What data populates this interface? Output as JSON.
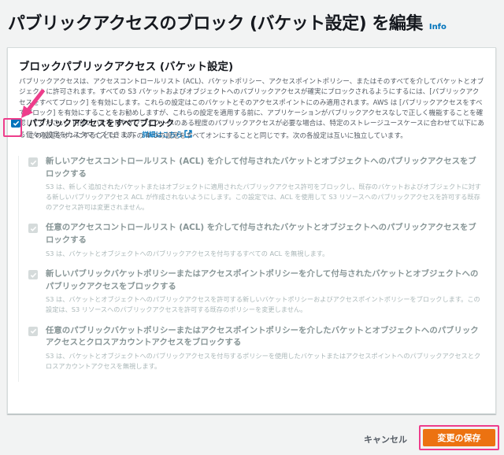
{
  "header": {
    "title": "パブリックアクセスのブロック (バケット設定) を編集",
    "info": "Info"
  },
  "panel": {
    "title": "ブロックパブリックアクセス (バケット設定)",
    "description": "パブリックアクセスは、アクセスコントロールリスト (ACL)、バケットポリシー、アクセスポイントポリシー、またはそのすべてを介してバケットとオブジェクトに許可されます。すべての S3 バケットおよびオブジェクトへのパブリックアクセスが確実にブロックされるようにするには、[パブリックアクセスをすべてブロック] を有効にします。これらの設定はこのバケットとそのアクセスポイントにのみ適用されます。AWS は [パブリックアクセスをすべてブロック] を有効にすることをお勧めしますが、これらの設定を適用する前に、アプリケーションがパブリックアクセスなしで正しく機能することを確認してください。内部のバケットやオブジェクトへのある程度のパブリックアクセスが必要な場合は、特定のストレージユースケースに合わせて以下にある個々の設定をカスタマイズできます。",
    "detail_link": "詳細はこちら"
  },
  "master": {
    "label": "パブリックアクセスをすべてブロック",
    "description": "この設定をオンにすることは、以下の 4 つの設定をすべてオンにすることと同じです。次の各設定は互いに独立しています。",
    "checked": true
  },
  "options": [
    {
      "title": "新しいアクセスコントロールリスト (ACL) を介して付与されたバケットとオブジェクトへのパブリックアクセスをブロックする",
      "description": "S3 は、新しく追加されたバケットまたはオブジェクトに適用されたパブリックアクセス許可をブロックし、既存のバケットおよびオブジェクトに対する新しいパブリックアクセス ACL が作成されないようにします。この設定では、ACL を使用して S3 リソースへのパブリックアクセスを許可する既存のアクセス許可は変更されません。"
    },
    {
      "title": "任意のアクセスコントロールリスト (ACL) を介して付与されたバケットとオブジェクトへのパブリックアクセスをブロックする",
      "description": "S3 は、バケットとオブジェクトへのパブリックアクセスを付与するすべての ACL を無視します。"
    },
    {
      "title": "新しいパブリックバケットポリシーまたはアクセスポイントポリシーを介して付与されたバケットとオブジェクトへのパブリックアクセスをブロックする",
      "description": "S3 は、バケットとオブジェクトへのパブリックアクセスを許可する新しいバケットポリシーおよびアクセスポイントポリシーをブロックします。この設定は、S3 リソースへのパブリックアクセスを許可する既存のポリシーを変更しません。"
    },
    {
      "title": "任意のパブリックバケットポリシーまたはアクセスポイントポリシーを介したバケットとオブジェクトへのパブリックアクセスとクロスアカウントアクセスをブロックする",
      "description": "S3 は、バケットとオブジェクトへのパブリックアクセスを付与するポリシーを使用したバケットまたはアクセスポイントへのパブリックアクセスとクロスアカウントアクセスを無視します。"
    }
  ],
  "footer": {
    "cancel_label": "キャンセル",
    "save_label": "変更の保存"
  },
  "colors": {
    "accent": "#0073bb",
    "primary_button": "#ec7211",
    "highlight": "#ee3d8b"
  },
  "icons": {
    "checkbox_check": "check-icon",
    "external_link": "external-link-icon",
    "annotation_arrow": "arrow-icon"
  }
}
